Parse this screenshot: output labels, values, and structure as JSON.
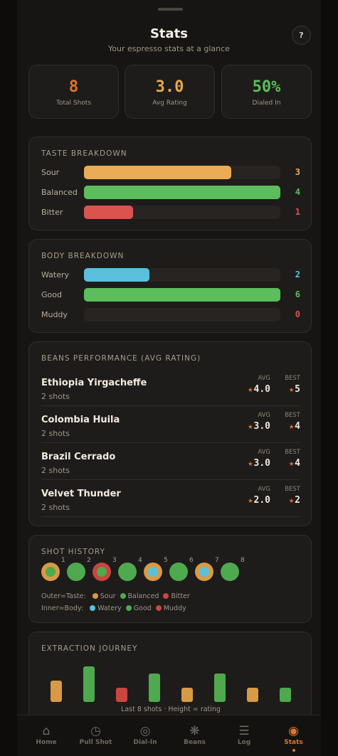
{
  "header": {
    "title": "Stats",
    "subtitle": "Your espresso stats at a glance",
    "help_label": "?"
  },
  "summary": [
    {
      "value": "8",
      "label": "Total Shots",
      "color": "#e0742e"
    },
    {
      "value": "3.0",
      "label": "Avg Rating",
      "color": "#e8a84b"
    },
    {
      "value": "50%",
      "label": "Dialed In",
      "color": "#5cbf5c"
    }
  ],
  "taste": {
    "title": "Taste Breakdown",
    "max": 4,
    "rows": [
      {
        "label": "Sour",
        "count": "3",
        "value": 3,
        "color": "#ecab55"
      },
      {
        "label": "Balanced",
        "count": "4",
        "value": 4,
        "color": "#5bbd5b"
      },
      {
        "label": "Bitter",
        "count": "1",
        "value": 1,
        "color": "#d9534f"
      }
    ]
  },
  "body": {
    "title": "Body Breakdown",
    "max": 6,
    "rows": [
      {
        "label": "Watery",
        "count": "2",
        "value": 2,
        "color": "#5bc0de"
      },
      {
        "label": "Good",
        "count": "6",
        "value": 6,
        "color": "#5bbd5b"
      },
      {
        "label": "Muddy",
        "count": "0",
        "value": 0,
        "color": "#d9534f"
      }
    ]
  },
  "beans": {
    "title": "Beans Performance (Avg Rating)",
    "avg_label": "AVG",
    "best_label": "BEST",
    "star": "★",
    "rows": [
      {
        "name": "Ethiopia Yirgacheffe",
        "shots": "2 shots",
        "avg": "4.0",
        "best": "5"
      },
      {
        "name": "Colombia Huila",
        "shots": "2 shots",
        "avg": "3.0",
        "best": "4"
      },
      {
        "name": "Brazil Cerrado",
        "shots": "2 shots",
        "avg": "3.0",
        "best": "4"
      },
      {
        "name": "Velvet Thunder",
        "shots": "2 shots",
        "avg": "2.0",
        "best": "2"
      }
    ]
  },
  "history": {
    "title": "Shot History",
    "shots": [
      {
        "n": "1",
        "taste": "sour",
        "body": "good"
      },
      {
        "n": "2",
        "taste": "balanced",
        "body": "good"
      },
      {
        "n": "3",
        "taste": "bitter",
        "body": "good"
      },
      {
        "n": "4",
        "taste": "balanced",
        "body": "good"
      },
      {
        "n": "5",
        "taste": "sour",
        "body": "watery"
      },
      {
        "n": "6",
        "taste": "balanced",
        "body": "good"
      },
      {
        "n": "7",
        "taste": "sour",
        "body": "watery"
      },
      {
        "n": "8",
        "taste": "balanced",
        "body": "good"
      }
    ],
    "colors": {
      "sour": "#d99a45",
      "balanced": "#4fa94f",
      "bitter": "#c9463f",
      "watery": "#5bc0de",
      "good": "#4fa94f",
      "muddy": "#c9463f"
    },
    "legend_outer_label": "Outer=Taste:",
    "legend_outer": [
      {
        "label": "Sour",
        "color": "#d99a45"
      },
      {
        "label": "Balanced",
        "color": "#4fa94f"
      },
      {
        "label": "Bitter",
        "color": "#c9463f"
      }
    ],
    "legend_inner_label": "Inner=Body:",
    "legend_inner": [
      {
        "label": "Watery",
        "color": "#5bc0de"
      },
      {
        "label": "Good",
        "color": "#4fa94f"
      },
      {
        "label": "Muddy",
        "color": "#c9463f"
      }
    ]
  },
  "journey": {
    "title": "Extraction Journey",
    "caption": "Last 8 shots · Height = rating",
    "bars": [
      {
        "rating": 3,
        "taste": "sour"
      },
      {
        "rating": 5,
        "taste": "balanced"
      },
      {
        "rating": 2,
        "taste": "bitter"
      },
      {
        "rating": 4,
        "taste": "balanced"
      },
      {
        "rating": 2,
        "taste": "sour"
      },
      {
        "rating": 4,
        "taste": "balanced"
      },
      {
        "rating": 2,
        "taste": "sour"
      },
      {
        "rating": 2,
        "taste": "balanced"
      }
    ],
    "colors": {
      "sour": "#d99a45",
      "balanced": "#4fa94f",
      "bitter": "#c9463f"
    }
  },
  "nav": [
    {
      "label": "Home",
      "icon": "home-icon",
      "glyph": "⌂",
      "active": false
    },
    {
      "label": "Pull Shot",
      "icon": "timer-icon",
      "glyph": "◷",
      "active": false
    },
    {
      "label": "Dial-In",
      "icon": "target-icon",
      "glyph": "◎",
      "active": false
    },
    {
      "label": "Beans",
      "icon": "bean-icon",
      "glyph": "❋",
      "active": false
    },
    {
      "label": "Log",
      "icon": "list-icon",
      "glyph": "☰",
      "active": false
    },
    {
      "label": "Stats",
      "icon": "stats-icon",
      "glyph": "◉",
      "active": true
    }
  ]
}
